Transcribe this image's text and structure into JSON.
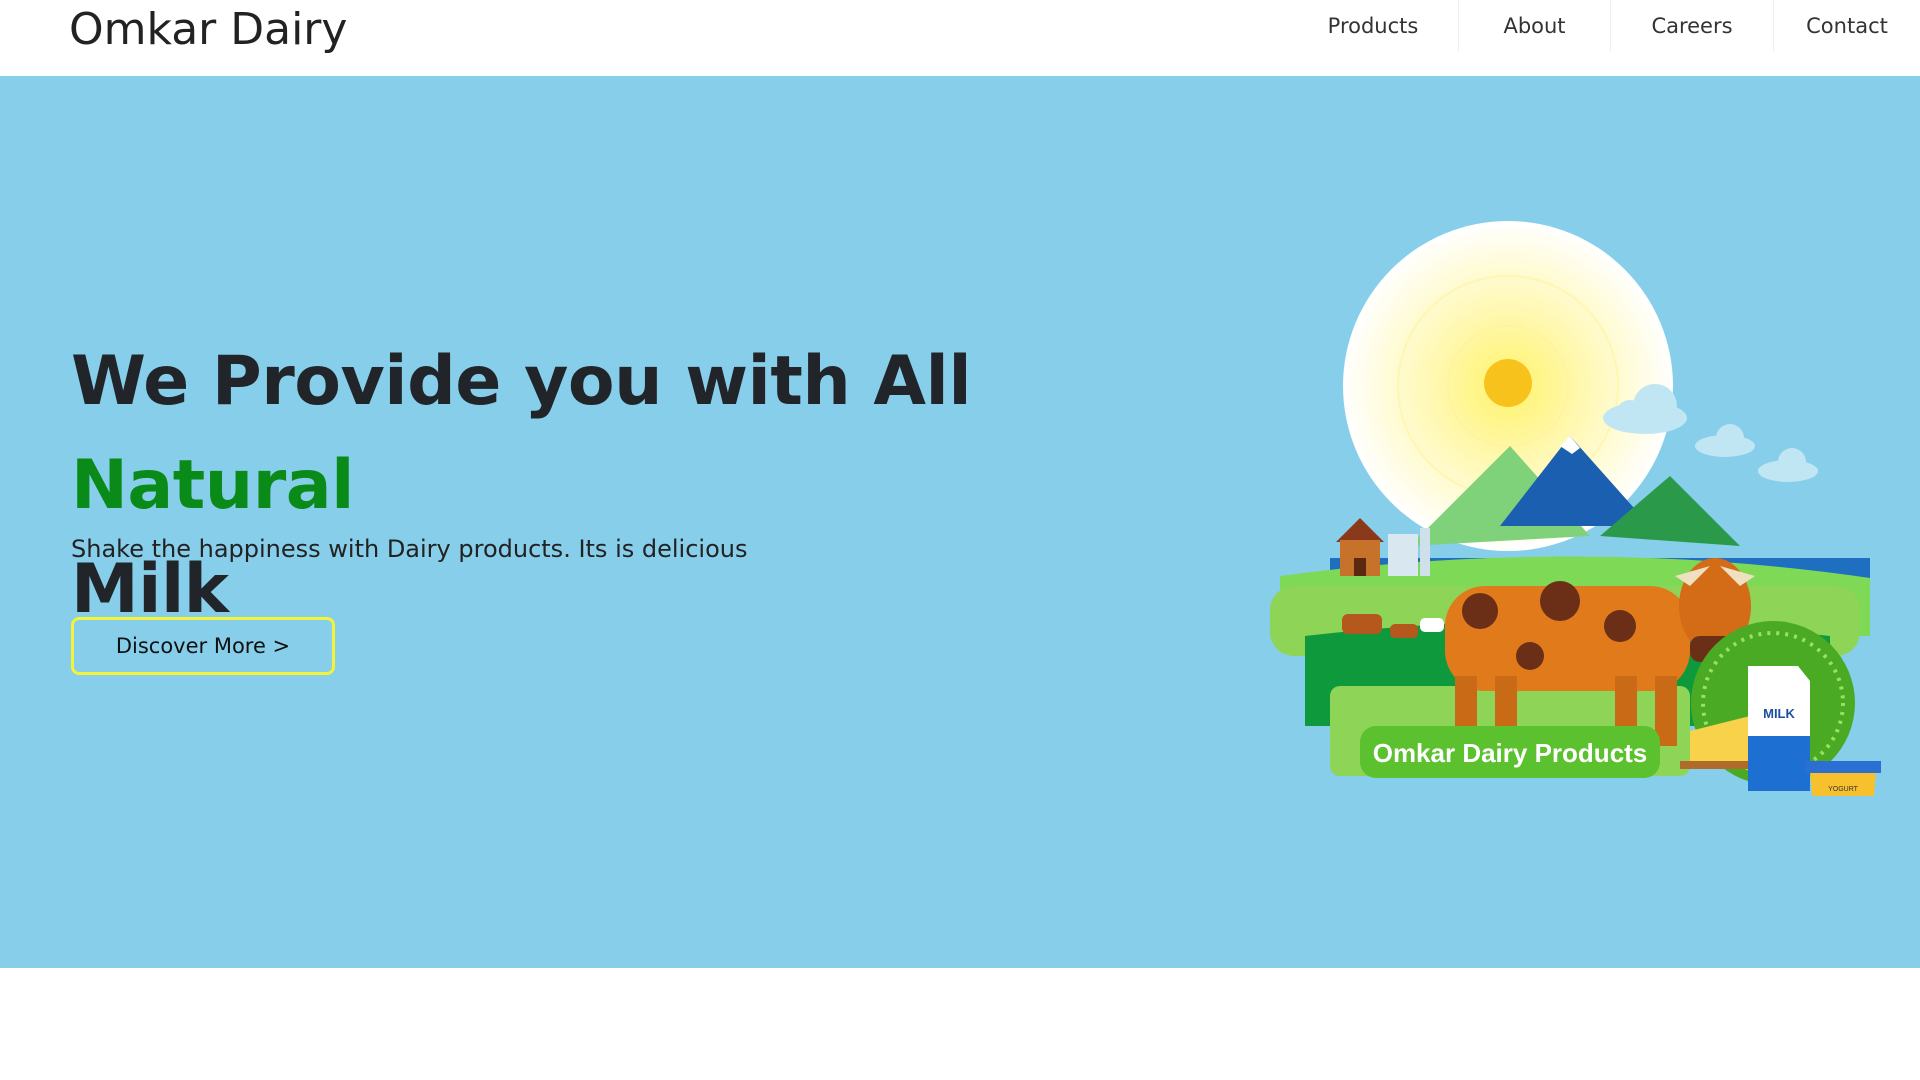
{
  "navbar": {
    "brand": "Omkar Dairy",
    "links": [
      "Products",
      "About",
      "Careers",
      "Contact"
    ]
  },
  "hero": {
    "headline_part1": "We Provide you with All ",
    "headline_accent": "Natural",
    "headline_part2": "Milk",
    "subtext": "Shake the happiness with Dairy products. Its is delicious",
    "button_label": "Discover More >",
    "illustration": {
      "banner_text": "Omkar Dairy Products",
      "milk_label": "MILK",
      "yogurt_label": "YOGURT"
    }
  },
  "colors": {
    "hero_bg": "#87ceeb",
    "accent_green": "#0a8a18",
    "button_border": "#f3f33a"
  }
}
